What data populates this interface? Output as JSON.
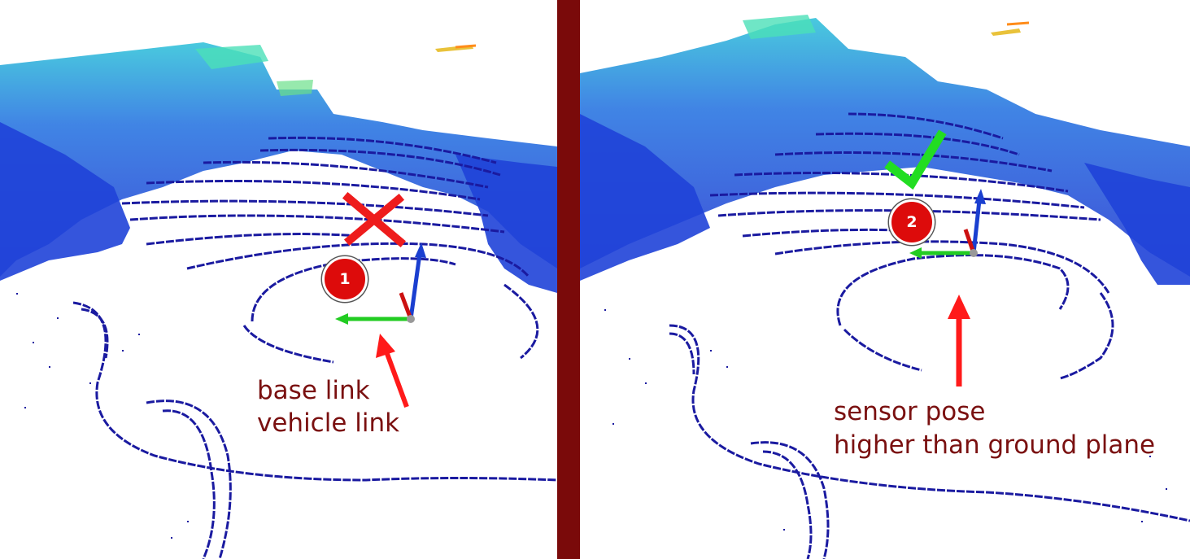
{
  "colors": {
    "divider": "#7a0a0a",
    "annotation_text": "#7a1010",
    "badge": "#dd0b0b",
    "arrow": "#ff1a1a",
    "cross": "#ee1c1c",
    "check": "#22dd22",
    "axis_x": "#cc1111",
    "axis_y": "#22cc22",
    "axis_z": "#1a3fd0",
    "points_near": "#1a1aa0",
    "points_far": "#2ab0e0"
  },
  "left": {
    "badge": "1",
    "status_icon": "cross-icon",
    "label_line1": "base link",
    "label_line2": "vehicle link"
  },
  "right": {
    "badge": "2",
    "status_icon": "check-icon",
    "label_line1": "sensor pose",
    "label_line2": "higher than ground plane"
  }
}
